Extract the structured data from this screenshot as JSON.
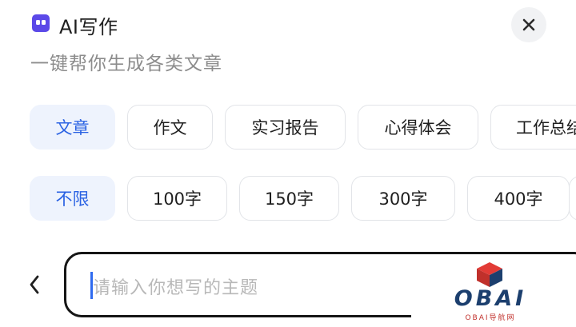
{
  "header": {
    "title": "AI写作",
    "icon": "quote-icon",
    "accent_color": "#5b49e8"
  },
  "subtitle": "一键帮你生成各类文章",
  "close": {
    "icon": "close-icon"
  },
  "type_chips": [
    {
      "label": "文章",
      "active": true
    },
    {
      "label": "作文",
      "active": false
    },
    {
      "label": "实习报告",
      "active": false
    },
    {
      "label": "心得体会",
      "active": false
    },
    {
      "label": "工作总结",
      "active": false
    }
  ],
  "length_chips": [
    {
      "label": "不限",
      "active": true
    },
    {
      "label": "100字",
      "active": false
    },
    {
      "label": "150字",
      "active": false
    },
    {
      "label": "300字",
      "active": false
    },
    {
      "label": "400字",
      "active": false
    },
    {
      "label": "",
      "active": false
    }
  ],
  "input": {
    "placeholder": "请输入你想写的主题"
  },
  "colors": {
    "active_chip_bg": "#eef3fd",
    "active_chip_text": "#2a62e3",
    "caret": "#2f6bf0"
  },
  "watermark": {
    "text": "OBAI",
    "subtext": "OBAI导航网"
  }
}
